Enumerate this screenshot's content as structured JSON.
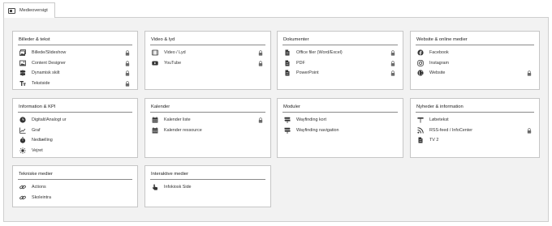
{
  "tab": {
    "label": "Medieoversigt"
  },
  "cards": [
    {
      "title": "Billeder & tekst",
      "items": [
        {
          "label": "Billede/Slideshow",
          "icon": "image-gallery-icon",
          "locked": true
        },
        {
          "label": "Content Designer",
          "icon": "content-designer-icon",
          "locked": true
        },
        {
          "label": "Dynamisk skilt",
          "icon": "sign-icon",
          "locked": true
        },
        {
          "label": "Tekstside",
          "icon": "text-icon",
          "locked": true
        }
      ]
    },
    {
      "title": "Video & lyd",
      "items": [
        {
          "label": "Video / Lyd",
          "icon": "video-icon",
          "locked": true
        },
        {
          "label": "YouTube",
          "icon": "youtube-icon",
          "locked": true
        }
      ]
    },
    {
      "title": "Dokumenter",
      "items": [
        {
          "label": "Office filer (Word/Excel)",
          "icon": "document-icon",
          "locked": true
        },
        {
          "label": "PDF",
          "icon": "document-icon",
          "locked": true
        },
        {
          "label": "PowerPoint",
          "icon": "document-icon",
          "locked": true
        }
      ]
    },
    {
      "title": "Website & online medier",
      "items": [
        {
          "label": "Facebook",
          "icon": "facebook-icon",
          "locked": false
        },
        {
          "label": "Instagram",
          "icon": "instagram-icon",
          "locked": false
        },
        {
          "label": "Website",
          "icon": "globe-icon",
          "locked": true
        }
      ]
    },
    {
      "title": "Information & KPI",
      "items": [
        {
          "label": "Digitalt/Analogt ur",
          "icon": "clock-icon",
          "locked": false
        },
        {
          "label": "Graf",
          "icon": "chart-icon",
          "locked": false
        },
        {
          "label": "Nedtælling",
          "icon": "stopwatch-icon",
          "locked": false
        },
        {
          "label": "Vejret",
          "icon": "sun-icon",
          "locked": false
        }
      ]
    },
    {
      "title": "Kalender",
      "items": [
        {
          "label": "Kalender liste",
          "icon": "calendar-icon",
          "locked": true
        },
        {
          "label": "Kalender ressource",
          "icon": "calendar-icon",
          "locked": false
        }
      ]
    },
    {
      "title": "Moduler",
      "items": [
        {
          "label": "Wayfinding kort",
          "icon": "signpost-icon",
          "locked": false
        },
        {
          "label": "Wayfinding navigation",
          "icon": "signpost-icon",
          "locked": false
        }
      ]
    },
    {
      "title": "Nyheder & information",
      "items": [
        {
          "label": "Løbetekst",
          "icon": "ticker-icon",
          "locked": false
        },
        {
          "label": "RSS-feed / InfoCenter",
          "icon": "rss-icon",
          "locked": true
        },
        {
          "label": "TV 2",
          "icon": "document-icon",
          "locked": false
        }
      ]
    },
    {
      "title": "Tekniske medier",
      "items": [
        {
          "label": "Actions",
          "icon": "link-icon",
          "locked": false
        },
        {
          "label": "Skoleintra",
          "icon": "link-icon",
          "locked": false
        }
      ]
    },
    {
      "title": "Interaktive medier",
      "items": [
        {
          "label": "Infokiosk Side",
          "icon": "hand-pointer-icon",
          "locked": false
        }
      ]
    }
  ]
}
